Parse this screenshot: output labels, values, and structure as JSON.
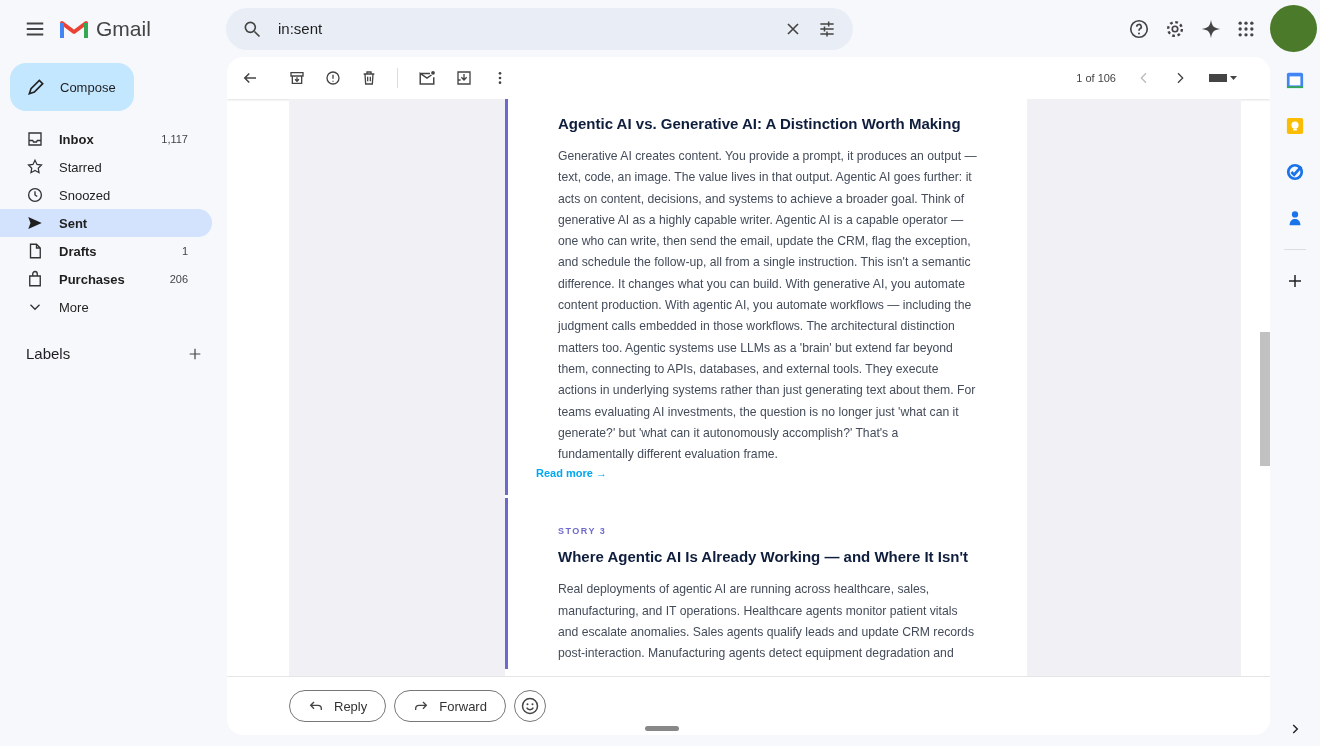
{
  "app": {
    "name": "Gmail"
  },
  "search": {
    "value": "in:sent"
  },
  "compose": {
    "label": "Compose"
  },
  "sidebar": {
    "items": [
      {
        "label": "Inbox",
        "count": "1,117",
        "unread": true,
        "selected": false
      },
      {
        "label": "Starred",
        "unread": false,
        "selected": false
      },
      {
        "label": "Snoozed",
        "unread": false,
        "selected": false
      },
      {
        "label": "Sent",
        "unread": true,
        "selected": true
      },
      {
        "label": "Drafts",
        "count": "1",
        "unread": true,
        "selected": false
      },
      {
        "label": "Purchases",
        "count": "206",
        "unread": true,
        "selected": false
      },
      {
        "label": "More",
        "unread": false,
        "selected": false
      }
    ],
    "labels_heading": "Labels"
  },
  "toolbar": {
    "pagination": "1 of 106"
  },
  "email": {
    "stories": [
      {
        "title": "Agentic AI vs. Generative AI: A Distinction Worth Making",
        "body": "Generative AI creates content. You provide a prompt, it produces an output — text, code, an image. The value lives in that output. Agentic AI goes further: it acts on content, decisions, and systems to achieve a broader goal. Think of generative AI as a highly capable writer. Agentic AI is a capable operator — one who can write, then send the email, update the CRM, flag the exception, and schedule the follow-up, all from a single instruction. This isn't a semantic difference. It changes what you can build. With generative AI, you automate content production. With agentic AI, you automate workflows — including the judgment calls embedded in those workflows. The architectural distinction matters too. Agentic systems use LLMs as a 'brain' but extend far beyond them, connecting to APIs, databases, and external tools. They execute actions in underlying systems rather than just generating text about them. For teams evaluating AI investments, the question is no longer just 'what can it generate?' but 'what can it autonomously accomplish?' That's a fundamentally different evaluation frame.",
        "link": "Read more →"
      },
      {
        "kicker": "STORY 3",
        "title": "Where Agentic AI Is Already Working — and Where It Isn't",
        "body": "Real deployments of agentic AI are running across healthcare, sales, manufacturing, and IT operations. Healthcare agents monitor patient vitals and escalate anomalies. Sales agents qualify leads and update CRM records post-interaction. Manufacturing agents detect equipment degradation and"
      }
    ]
  },
  "actions": {
    "reply": "Reply",
    "forward": "Forward"
  }
}
